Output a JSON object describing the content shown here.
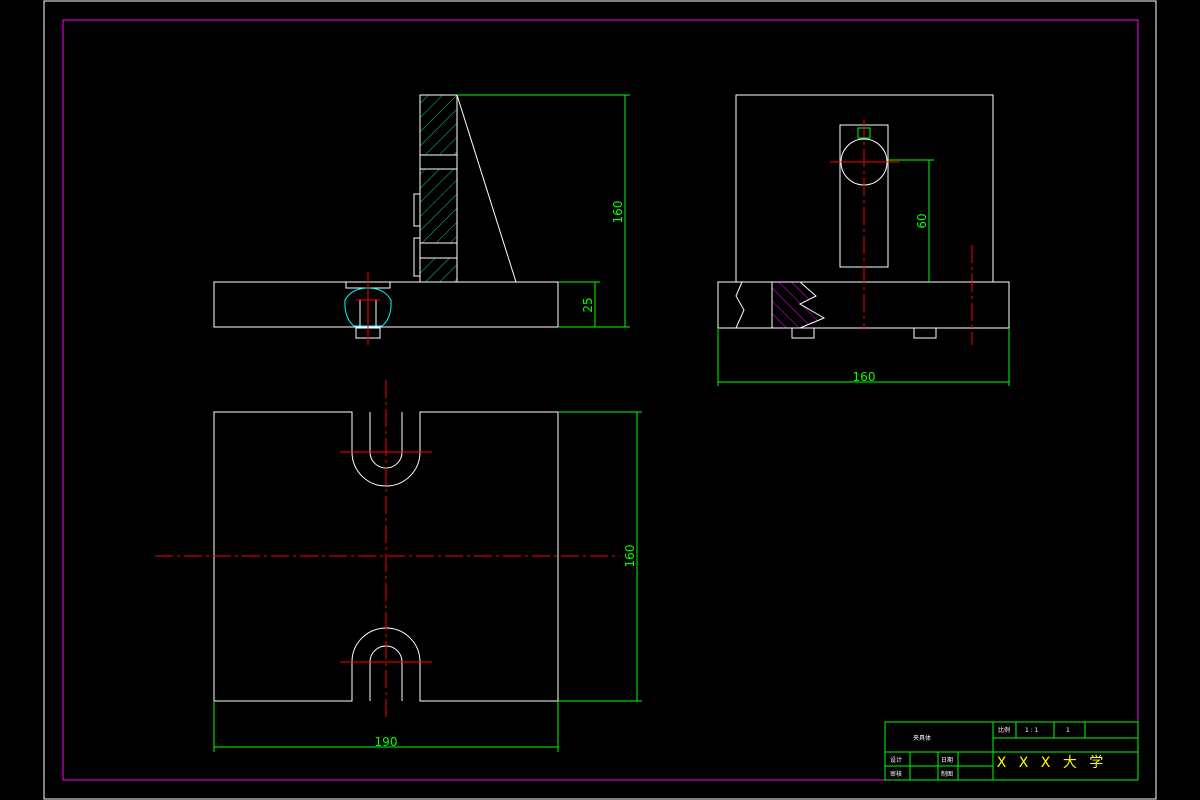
{
  "dimensions": {
    "front_height": "160",
    "front_base_height": "25",
    "side_hole_height": "60",
    "side_width": "160",
    "top_depth": "160",
    "top_width": "190"
  },
  "title_block": {
    "part_name": "夹具体",
    "scale_label": "比例",
    "scale_value": "1 : 1",
    "quantity_value": "1",
    "designer_label": "设计",
    "checker_label": "审核",
    "date_label": "日期",
    "drawn_label": "制图",
    "school": "X X X 大 学"
  },
  "colors": {
    "background": "#000000",
    "outline": "#ffffff",
    "dimension": "#00ff00",
    "centerline": "#ff0000",
    "frame": "#ff00ff"
  }
}
